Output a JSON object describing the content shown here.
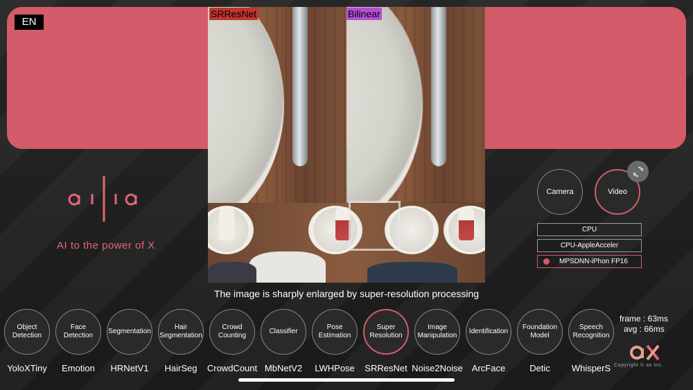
{
  "language": "EN",
  "compare": {
    "left_label": "SRResNet",
    "right_label": "Bilinear"
  },
  "caption": "The image is sharply enlarged by super-resolution processing",
  "brand": {
    "tagline": "AI to the power of X",
    "copyright": "Copyright © ax Inc."
  },
  "source": {
    "camera": "Camera",
    "video": "Video",
    "selected": "Video"
  },
  "environments": [
    {
      "label": "CPU",
      "selected": false
    },
    {
      "label": "CPU-AppleAcceler",
      "selected": false
    },
    {
      "label": "MPSDNN-iPhon FP16",
      "selected": true
    }
  ],
  "models": [
    {
      "category": "Object Detection",
      "name": "YoloXTiny",
      "active": false
    },
    {
      "category": "Face Detection",
      "name": "Emotion",
      "active": false
    },
    {
      "category": "Segmentation",
      "name": "HRNetV1",
      "active": false
    },
    {
      "category": "Hair Segmentation",
      "name": "HairSeg",
      "active": false
    },
    {
      "category": "Crowd Counting",
      "name": "CrowdCount",
      "active": false
    },
    {
      "category": "Classifier",
      "name": "MbNetV2",
      "active": false
    },
    {
      "category": "Pose Estimation",
      "name": "LWHPose",
      "active": false
    },
    {
      "category": "Super Resolution",
      "name": "SRResNet",
      "active": true
    },
    {
      "category": "Image Manipulation",
      "name": "Noise2Noise",
      "active": false
    },
    {
      "category": "Identification",
      "name": "ArcFace",
      "active": false
    },
    {
      "category": "Foundation Model",
      "name": "Detic",
      "active": false
    },
    {
      "category": "Speech Recognition",
      "name": "WhisperS",
      "active": false
    }
  ],
  "stats": {
    "frame": "frame : 63ms",
    "avg": "avg : 66ms"
  },
  "colors": {
    "accent": "#d45b6a",
    "background": "#1f1f1f"
  },
  "icons": {
    "refresh": "refresh-icon",
    "logo": "ailia-logo",
    "ax_logo": "ax-logo"
  }
}
